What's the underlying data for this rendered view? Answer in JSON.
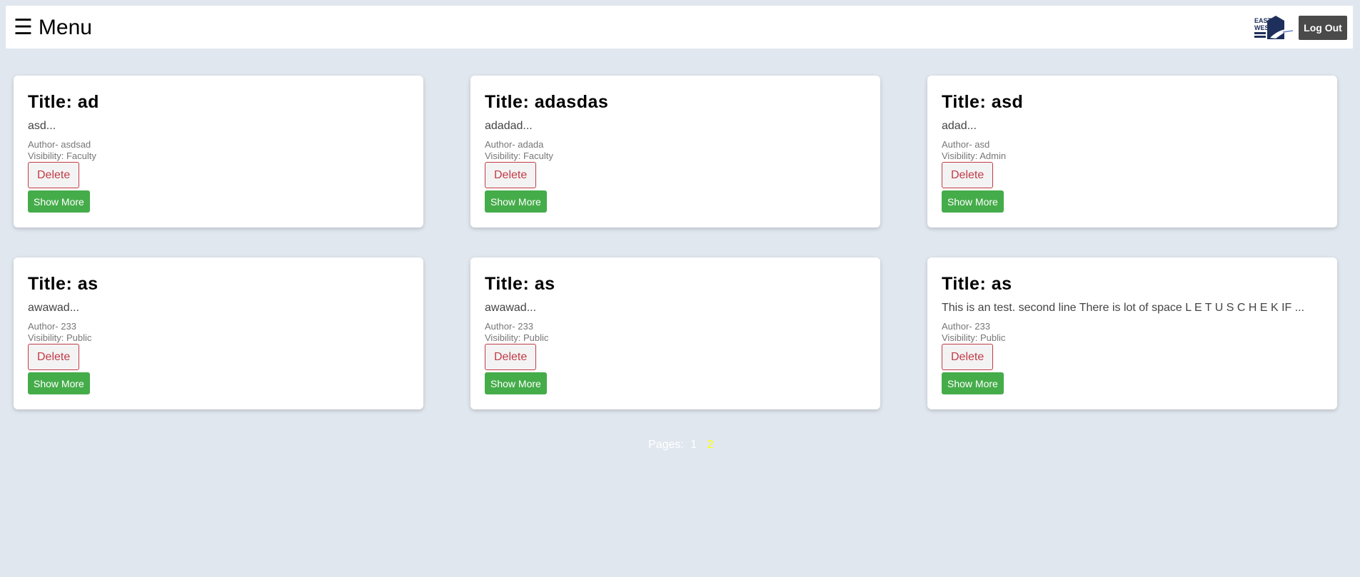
{
  "header": {
    "menu_icon": "☰",
    "menu_label": "Menu",
    "logo_text": "EAST WEST",
    "logout_label": "Log Out"
  },
  "cards": [
    {
      "title": "Title: ad",
      "description": "asd...",
      "author": "Author- asdsad",
      "visibility": "Visibility: Faculty",
      "delete_label": "Delete",
      "show_more_label": "Show More"
    },
    {
      "title": "Title: adasdas",
      "description": "adadad...",
      "author": "Author- adada",
      "visibility": "Visibility: Faculty",
      "delete_label": "Delete",
      "show_more_label": "Show More"
    },
    {
      "title": "Title: asd",
      "description": "adad...",
      "author": "Author- asd",
      "visibility": "Visibility: Admin",
      "delete_label": "Delete",
      "show_more_label": "Show More"
    },
    {
      "title": "Title: as",
      "description": "awawad...",
      "author": "Author- 233",
      "visibility": "Visibility: Public",
      "delete_label": "Delete",
      "show_more_label": "Show More"
    },
    {
      "title": "Title: as",
      "description": "awawad...",
      "author": "Author- 233",
      "visibility": "Visibility: Public",
      "delete_label": "Delete",
      "show_more_label": "Show More"
    },
    {
      "title": "Title: as",
      "description": "This is an test. second line There is lot of space L E T U S C H E K IF ...",
      "author": "Author- 233",
      "visibility": "Visibility: Public",
      "delete_label": "Delete",
      "show_more_label": "Show More"
    }
  ],
  "pagination": {
    "label": "Pages:",
    "pages": [
      "1",
      "2"
    ],
    "current_page": "2"
  },
  "colors": {
    "background": "#e1e7ef",
    "show_more": "#45ac4a",
    "delete": "#c13b46",
    "logout": "#4a4a4a",
    "active_page": "#ffff00",
    "logo_navy": "#1f2f5c"
  }
}
